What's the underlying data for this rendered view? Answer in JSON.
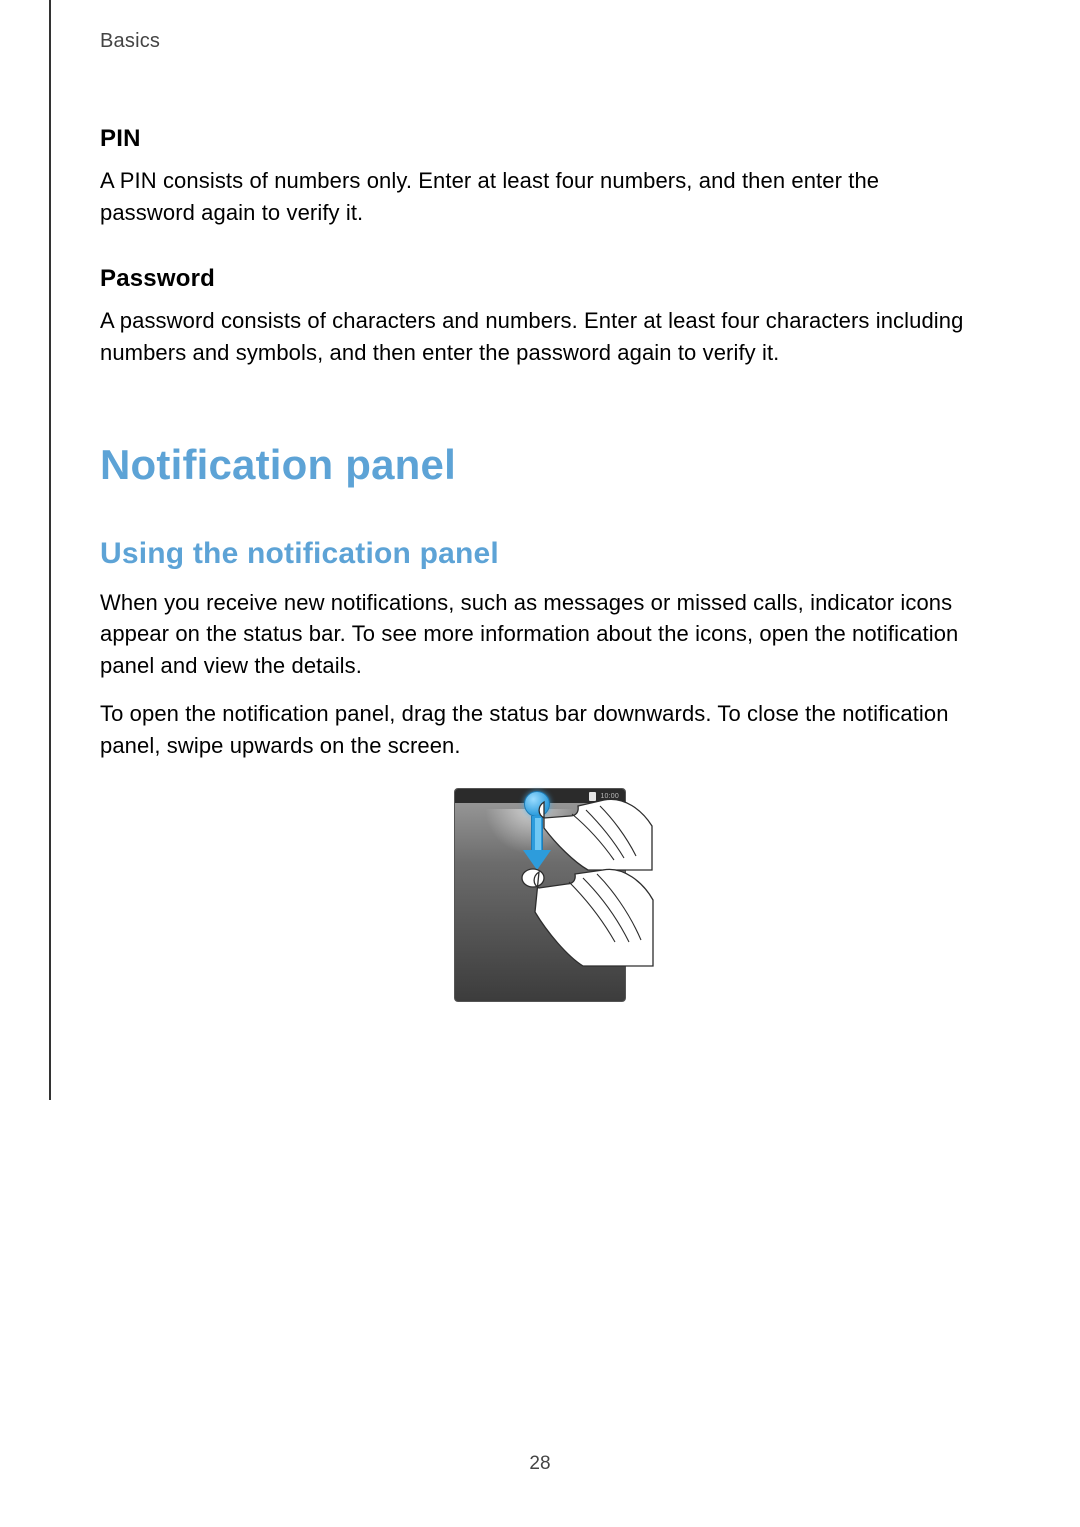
{
  "header": {
    "section": "Basics"
  },
  "pin": {
    "heading": "PIN",
    "body": "A PIN consists of numbers only. Enter at least four numbers, and then enter the password again to verify it."
  },
  "password": {
    "heading": "Password",
    "body": "A password consists of characters and numbers. Enter at least four characters including numbers and symbols, and then enter the password again to verify it."
  },
  "notification": {
    "h1": "Notification panel",
    "h2": "Using the notification panel",
    "p1": "When you receive new notifications, such as messages or missed calls, indicator icons appear on the status bar. To see more information about the icons, open the notification panel and view the details.",
    "p2": "To open the notification panel, drag the status bar downwards. To close the notification panel, swipe upwards on the screen."
  },
  "figure": {
    "status_time": "10:00"
  },
  "page_number": "28"
}
